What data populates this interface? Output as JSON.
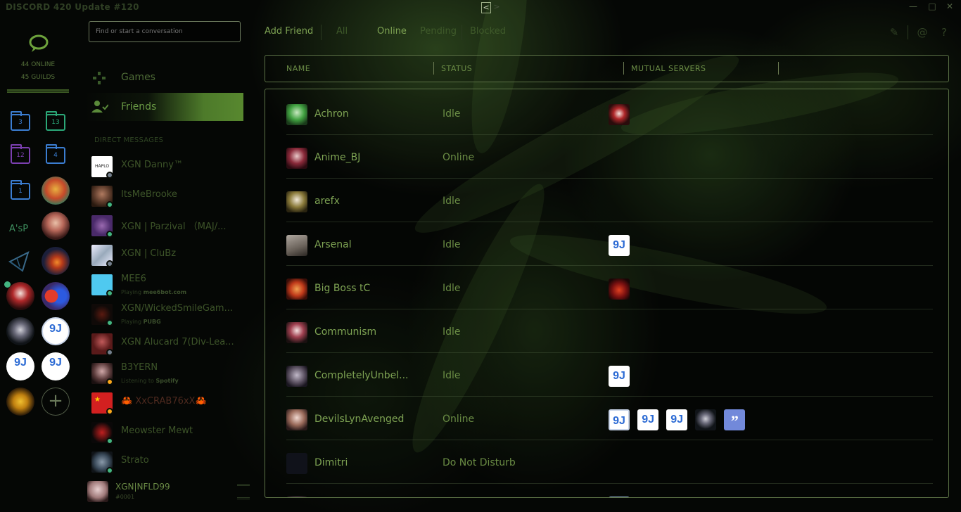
{
  "app": {
    "title": "DISCORD 420 Update #120",
    "back": "<",
    "forward": ">"
  },
  "guilds": {
    "online": "44 ONLINE",
    "count": "45 GUILDS",
    "folders": [
      "3",
      "13",
      "12",
      "4",
      "1"
    ],
    "text_icon": "A'sP",
    "badge_text": "9J"
  },
  "dm": {
    "search_placeholder": "Find or start a conversation",
    "nav": {
      "games": "Games",
      "friends": "Friends"
    },
    "header": "DIRECT MESSAGES",
    "items": [
      {
        "name": "XGN Danny™"
      },
      {
        "name": "ItsMeBrooke"
      },
      {
        "name": "XGN | Parzival （MAJ/..."
      },
      {
        "name": "XGN | CluBz"
      },
      {
        "name": "MEE6",
        "activity_prefix": "Playing",
        "activity_target": "mee6bot.com"
      },
      {
        "name": "XGN/WickedSmileGam...",
        "activity_prefix": "Playing",
        "activity_target": "PUBG"
      },
      {
        "name": "XGN Alucard 7(Div-Lea..."
      },
      {
        "name": "B3YERN",
        "activity_prefix": "Listening to",
        "activity_target": "Spotify"
      },
      {
        "name": "🦀 XxCRAB76xX🦀"
      },
      {
        "name": "Meowster Mewt"
      },
      {
        "name": "Strato"
      }
    ]
  },
  "user": {
    "name": "XGN|NFLD99",
    "tag": "#0001"
  },
  "main": {
    "tabs": [
      "Add Friend",
      "All",
      "Online",
      "Pending",
      "Blocked"
    ],
    "columns": [
      "NAME",
      "STATUS",
      "MUTUAL SERVERS"
    ]
  },
  "friends": [
    {
      "name": "Achron",
      "status": "Idle"
    },
    {
      "name": "Anime_BJ",
      "status": "Online"
    },
    {
      "name": "arefx",
      "status": "Idle"
    },
    {
      "name": "Arsenal",
      "status": "Idle"
    },
    {
      "name": "Big Boss tC",
      "status": "Idle"
    },
    {
      "name": "Communism",
      "status": "Idle"
    },
    {
      "name": "CompletelyUnbel...",
      "status": "Idle"
    },
    {
      "name": "DevilsLynAvenged",
      "status": "Online"
    },
    {
      "name": "Dimitri",
      "status": "Do Not Disturb"
    }
  ],
  "colors": {
    "accent": "#7ea353",
    "background": "#050705",
    "online": "#43b581",
    "idle": "#faa61a",
    "offline": "#747f8d"
  }
}
